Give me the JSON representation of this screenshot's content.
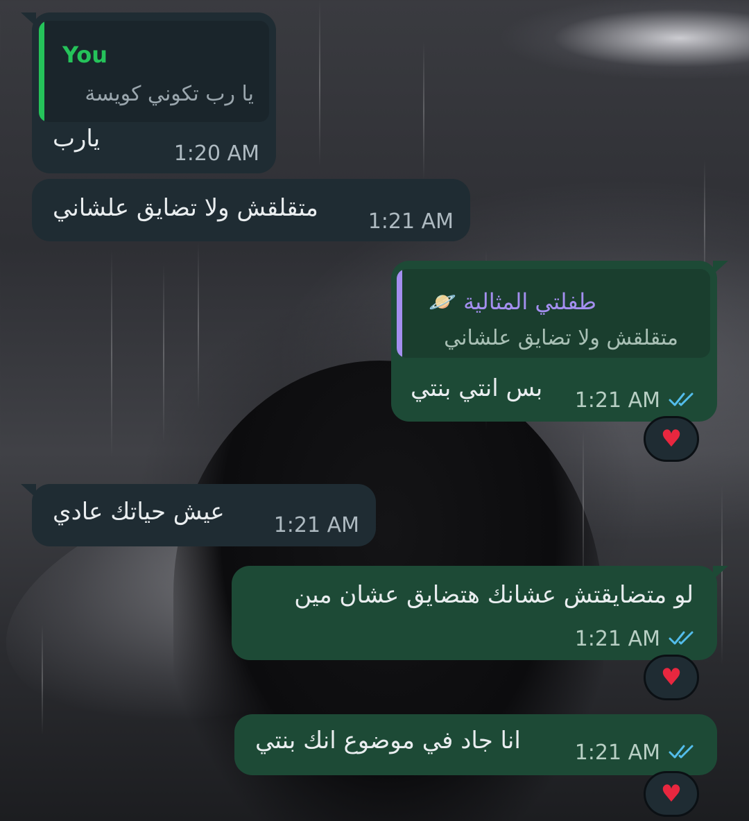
{
  "messages": [
    {
      "direction": "incoming",
      "quote": {
        "author": "You",
        "text": "يا رب تكوني كويسة"
      },
      "text": "يارب",
      "time": "1:20 AM"
    },
    {
      "direction": "incoming",
      "text": "متقلقش ولا تضايق علشاني",
      "time": "1:21 AM"
    },
    {
      "direction": "outgoing",
      "quote": {
        "author": "طفلتي المثالية 🪐",
        "text": "متقلقش ولا تضايق علشاني"
      },
      "text": "بس انتي بنتي",
      "time": "1:21 AM",
      "reaction": "❤️"
    },
    {
      "direction": "incoming",
      "text": "عيش حياتك عادي",
      "time": "1:21 AM"
    },
    {
      "direction": "outgoing",
      "text": "لو متضايقتش عشانك هتضايق عشان مين",
      "time": "1:21 AM",
      "reaction": "❤️"
    },
    {
      "direction": "outgoing",
      "text": "انا جاد في موضوع انك بنتي",
      "time": "1:21 AM",
      "reaction": "❤️"
    }
  ],
  "colors": {
    "incoming_bubble": "#1f2c33",
    "outgoing_bubble": "#1d4a36",
    "quote_you_accent": "#25c35a",
    "quote_contact_accent": "#a48ff0",
    "read_ticks": "#53bdeb"
  },
  "icons": {
    "read_receipt": "double-check-icon",
    "reaction": "heart-icon"
  }
}
